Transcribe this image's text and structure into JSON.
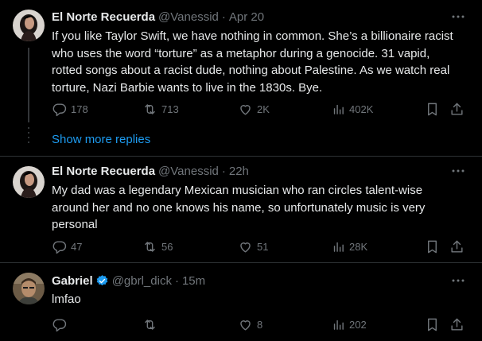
{
  "thread": {
    "show_more_label": "Show more replies"
  },
  "tweets": [
    {
      "name": "El Norte Recuerda",
      "handle": "@Vanessid",
      "time": "Apr 20",
      "lines": [
        "If you like Taylor Swift, we have nothing in common. She’s a billionaire racist",
        "who uses the word “torture” as a metaphor during a genocide. 31 vapid,",
        "rotted songs about a racist dude, nothing about Palestine. As we watch real",
        "torture, Nazi Barbie wants to live in the 1830s. Bye."
      ],
      "replies": "178",
      "reposts": "713",
      "likes": "2K",
      "views": "402K"
    },
    {
      "name": "El Norte Recuerda",
      "handle": "@Vanessid",
      "time": "22h",
      "lines": [
        "My dad was a legendary Mexican musician who ran circles talent-wise",
        "around her and no one knows his name, so unfortunately music is very",
        "personal"
      ],
      "replies": "47",
      "reposts": "56",
      "likes": "51",
      "views": "28K"
    },
    {
      "name": "Gabriel",
      "handle": "@gbrl_dick",
      "time": "15m",
      "lines": [
        "lmfao"
      ],
      "replies": "",
      "reposts": "",
      "likes": "8",
      "views": "202"
    }
  ],
  "colors": {
    "background": "#000000",
    "text": "#e7e9ea",
    "muted": "#71767b",
    "link": "#1d9bf0",
    "verified": "#1d9bf0"
  },
  "icons": [
    "more-icon",
    "reply-icon",
    "repost-icon",
    "like-icon",
    "views-icon",
    "bookmark-icon",
    "share-icon",
    "verified-badge-icon"
  ]
}
